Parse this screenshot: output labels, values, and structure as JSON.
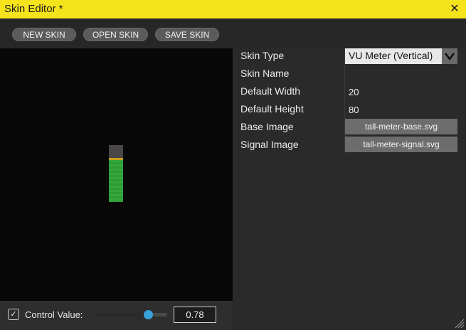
{
  "window": {
    "title": "Skin Editor *",
    "close_glyph": "✕"
  },
  "toolbar": {
    "new_skin_label": "NEW SKIN",
    "open_skin_label": "OPEN SKIN",
    "save_skin_label": "SAVE SKIN"
  },
  "preview": {
    "signal_level": 0.78,
    "base_image_color": "#4a4546",
    "signal_color": "#34a83c"
  },
  "control": {
    "checked": true,
    "check_glyph": "✓",
    "label": "Control Value:",
    "value": 0.78,
    "value_text": "0.78",
    "thumb_color": "#3aa0d8"
  },
  "properties": {
    "skin_type_label": "Skin Type",
    "skin_type_value": "VU Meter (Vertical)",
    "skin_type_arrow": "⌄",
    "skin_name_label": "Skin Name",
    "skin_name_value": "",
    "default_width_label": "Default Width",
    "default_width_value": "20",
    "default_height_label": "Default Height",
    "default_height_value": "80",
    "base_image_label": "Base Image",
    "base_image_value": "tall-meter-base.svg",
    "signal_image_label": "Signal Image",
    "signal_image_value": "tall-meter-signal.svg"
  },
  "colors": {
    "title_bar": "#f5e31c",
    "accent": "#3aa0d8"
  }
}
